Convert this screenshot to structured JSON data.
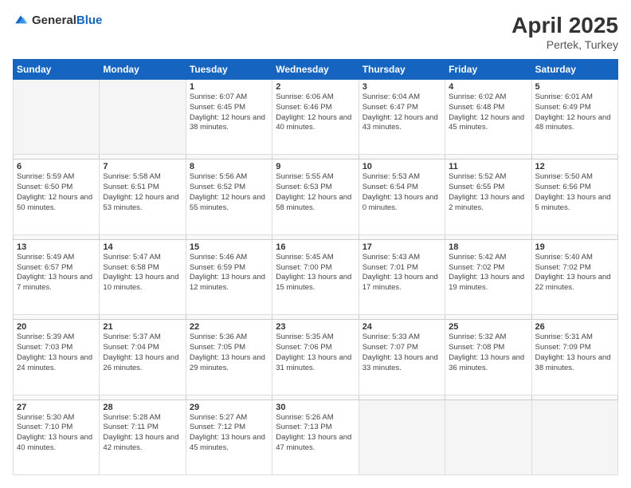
{
  "logo": {
    "general": "General",
    "blue": "Blue"
  },
  "header": {
    "month": "April 2025",
    "location": "Pertek, Turkey"
  },
  "weekdays": [
    "Sunday",
    "Monday",
    "Tuesday",
    "Wednesday",
    "Thursday",
    "Friday",
    "Saturday"
  ],
  "weeks": [
    [
      {
        "day": "",
        "info": ""
      },
      {
        "day": "",
        "info": ""
      },
      {
        "day": "1",
        "info": "Sunrise: 6:07 AM\nSunset: 6:45 PM\nDaylight: 12 hours and 38 minutes."
      },
      {
        "day": "2",
        "info": "Sunrise: 6:06 AM\nSunset: 6:46 PM\nDaylight: 12 hours and 40 minutes."
      },
      {
        "day": "3",
        "info": "Sunrise: 6:04 AM\nSunset: 6:47 PM\nDaylight: 12 hours and 43 minutes."
      },
      {
        "day": "4",
        "info": "Sunrise: 6:02 AM\nSunset: 6:48 PM\nDaylight: 12 hours and 45 minutes."
      },
      {
        "day": "5",
        "info": "Sunrise: 6:01 AM\nSunset: 6:49 PM\nDaylight: 12 hours and 48 minutes."
      }
    ],
    [
      {
        "day": "6",
        "info": "Sunrise: 5:59 AM\nSunset: 6:50 PM\nDaylight: 12 hours and 50 minutes."
      },
      {
        "day": "7",
        "info": "Sunrise: 5:58 AM\nSunset: 6:51 PM\nDaylight: 12 hours and 53 minutes."
      },
      {
        "day": "8",
        "info": "Sunrise: 5:56 AM\nSunset: 6:52 PM\nDaylight: 12 hours and 55 minutes."
      },
      {
        "day": "9",
        "info": "Sunrise: 5:55 AM\nSunset: 6:53 PM\nDaylight: 12 hours and 58 minutes."
      },
      {
        "day": "10",
        "info": "Sunrise: 5:53 AM\nSunset: 6:54 PM\nDaylight: 13 hours and 0 minutes."
      },
      {
        "day": "11",
        "info": "Sunrise: 5:52 AM\nSunset: 6:55 PM\nDaylight: 13 hours and 2 minutes."
      },
      {
        "day": "12",
        "info": "Sunrise: 5:50 AM\nSunset: 6:56 PM\nDaylight: 13 hours and 5 minutes."
      }
    ],
    [
      {
        "day": "13",
        "info": "Sunrise: 5:49 AM\nSunset: 6:57 PM\nDaylight: 13 hours and 7 minutes."
      },
      {
        "day": "14",
        "info": "Sunrise: 5:47 AM\nSunset: 6:58 PM\nDaylight: 13 hours and 10 minutes."
      },
      {
        "day": "15",
        "info": "Sunrise: 5:46 AM\nSunset: 6:59 PM\nDaylight: 13 hours and 12 minutes."
      },
      {
        "day": "16",
        "info": "Sunrise: 5:45 AM\nSunset: 7:00 PM\nDaylight: 13 hours and 15 minutes."
      },
      {
        "day": "17",
        "info": "Sunrise: 5:43 AM\nSunset: 7:01 PM\nDaylight: 13 hours and 17 minutes."
      },
      {
        "day": "18",
        "info": "Sunrise: 5:42 AM\nSunset: 7:02 PM\nDaylight: 13 hours and 19 minutes."
      },
      {
        "day": "19",
        "info": "Sunrise: 5:40 AM\nSunset: 7:02 PM\nDaylight: 13 hours and 22 minutes."
      }
    ],
    [
      {
        "day": "20",
        "info": "Sunrise: 5:39 AM\nSunset: 7:03 PM\nDaylight: 13 hours and 24 minutes."
      },
      {
        "day": "21",
        "info": "Sunrise: 5:37 AM\nSunset: 7:04 PM\nDaylight: 13 hours and 26 minutes."
      },
      {
        "day": "22",
        "info": "Sunrise: 5:36 AM\nSunset: 7:05 PM\nDaylight: 13 hours and 29 minutes."
      },
      {
        "day": "23",
        "info": "Sunrise: 5:35 AM\nSunset: 7:06 PM\nDaylight: 13 hours and 31 minutes."
      },
      {
        "day": "24",
        "info": "Sunrise: 5:33 AM\nSunset: 7:07 PM\nDaylight: 13 hours and 33 minutes."
      },
      {
        "day": "25",
        "info": "Sunrise: 5:32 AM\nSunset: 7:08 PM\nDaylight: 13 hours and 36 minutes."
      },
      {
        "day": "26",
        "info": "Sunrise: 5:31 AM\nSunset: 7:09 PM\nDaylight: 13 hours and 38 minutes."
      }
    ],
    [
      {
        "day": "27",
        "info": "Sunrise: 5:30 AM\nSunset: 7:10 PM\nDaylight: 13 hours and 40 minutes."
      },
      {
        "day": "28",
        "info": "Sunrise: 5:28 AM\nSunset: 7:11 PM\nDaylight: 13 hours and 42 minutes."
      },
      {
        "day": "29",
        "info": "Sunrise: 5:27 AM\nSunset: 7:12 PM\nDaylight: 13 hours and 45 minutes."
      },
      {
        "day": "30",
        "info": "Sunrise: 5:26 AM\nSunset: 7:13 PM\nDaylight: 13 hours and 47 minutes."
      },
      {
        "day": "",
        "info": ""
      },
      {
        "day": "",
        "info": ""
      },
      {
        "day": "",
        "info": ""
      }
    ]
  ]
}
